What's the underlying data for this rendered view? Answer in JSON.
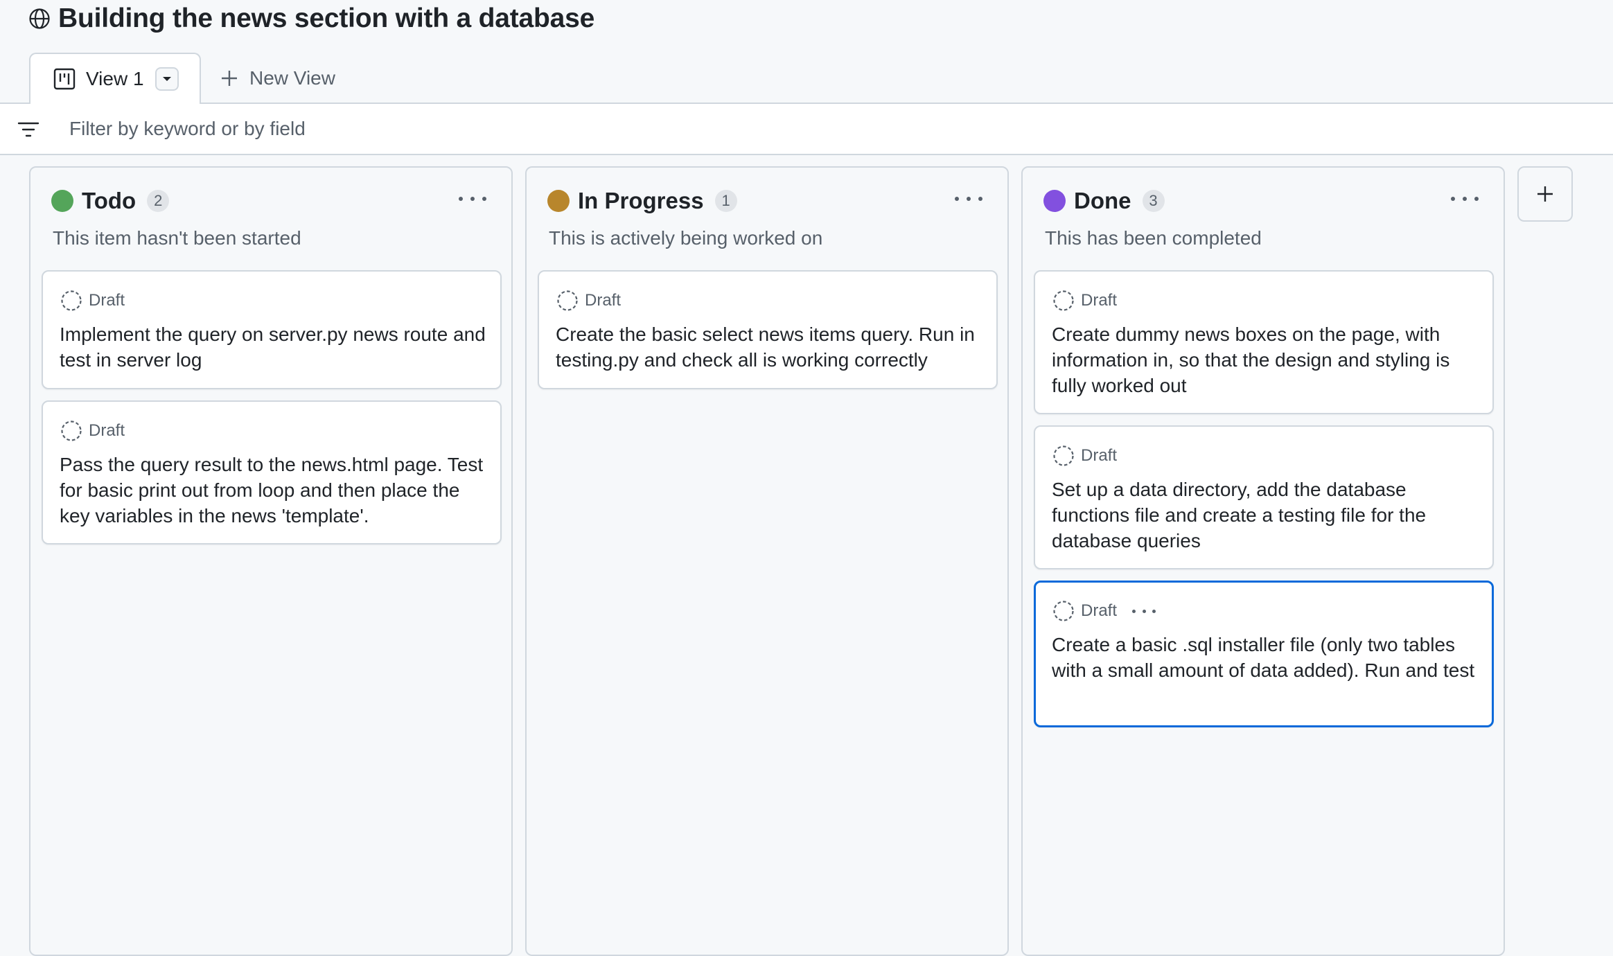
{
  "project": {
    "title": "Building the news section with a database"
  },
  "views": {
    "active_tab": "View 1",
    "new_view_label": "New View"
  },
  "filter": {
    "placeholder": "Filter by keyword or by field",
    "value": ""
  },
  "columns": [
    {
      "name": "Todo",
      "count": "2",
      "color": "#54a55a",
      "description": "This item hasn't been started",
      "cards": [
        {
          "type": "Draft",
          "text": "Implement the query on server.py news route and test in server log"
        },
        {
          "type": "Draft",
          "text": "Pass the query result to the news.html page. Test for basic print out from loop and then place the key variables in the news 'template'."
        }
      ]
    },
    {
      "name": "In Progress",
      "count": "1",
      "color": "#b8862c",
      "description": "This is actively being worked on",
      "cards": [
        {
          "type": "Draft",
          "text": "Create the basic select news items query. Run in testing.py and check all is working correctly"
        }
      ]
    },
    {
      "name": "Done",
      "count": "3",
      "color": "#8250df",
      "description": "This has been completed",
      "cards": [
        {
          "type": "Draft",
          "text": "Create dummy news boxes on the page, with information in, so that the design and styling is fully worked out"
        },
        {
          "type": "Draft",
          "text": "Set up a data directory, add the database functions file and create a testing file for the database queries"
        },
        {
          "type": "Draft",
          "text": "Create a basic .sql installer file (only two tables with a small amount of data added). Run and test",
          "selected": true
        }
      ]
    }
  ],
  "icons": {
    "title": "globe-icon",
    "view_tab": "board-icon",
    "filter": "filter-icon",
    "card_type": "draft-circle-icon",
    "add_column": "plus-icon"
  },
  "colors": {
    "selected_border": "#0969da",
    "muted_text": "#57606a"
  }
}
